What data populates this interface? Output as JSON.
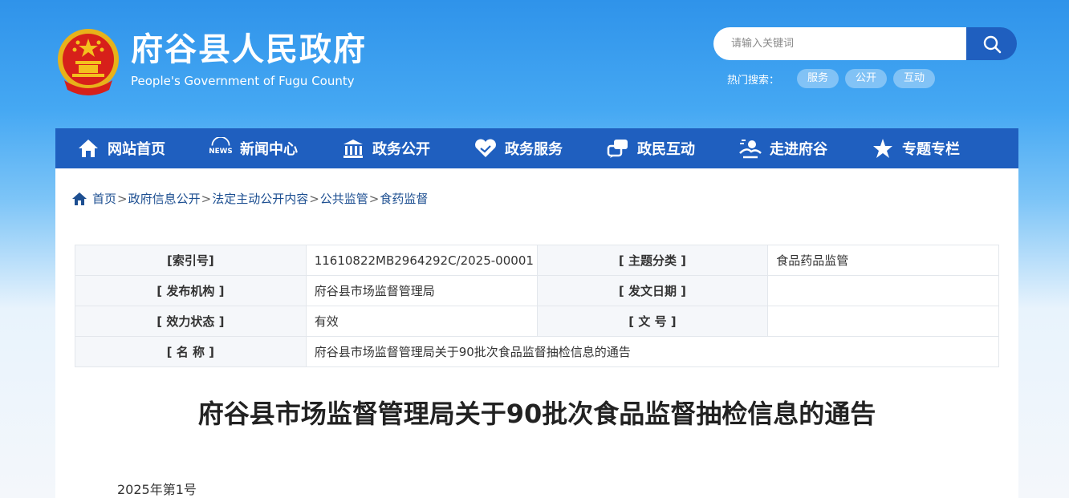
{
  "header": {
    "title": "府谷县人民政府",
    "subtitle": "People's Government of Fugu County",
    "search_placeholder": "请输入关键词",
    "hot_label": "热门搜索：",
    "hot_tags": [
      "服务",
      "公开",
      "互动"
    ]
  },
  "nav": [
    {
      "label": "网站首页",
      "icon": "home-icon"
    },
    {
      "label": "新闻中心",
      "icon": "news-icon"
    },
    {
      "label": "政务公开",
      "icon": "government-building-icon"
    },
    {
      "label": "政务服务",
      "icon": "heart-hand-icon"
    },
    {
      "label": "政民互动",
      "icon": "chat-icon"
    },
    {
      "label": "走进府谷",
      "icon": "landscape-icon"
    },
    {
      "label": "专题专栏",
      "icon": "star-icon"
    }
  ],
  "breadcrumb": [
    "首页",
    "政府信息公开",
    "法定主动公开内容",
    "公共监管",
    "食药监督"
  ],
  "meta": {
    "rows": [
      [
        "[索引号]",
        "11610822MB2964292C/2025-00001",
        "[ 主题分类 ]",
        "食品药品监管"
      ],
      [
        "[ 发布机构 ]",
        "府谷县市场监督管理局",
        "[ 发文日期 ]",
        ""
      ],
      [
        "[ 效力状态 ]",
        "有效",
        "[ 文 号 ]",
        ""
      ]
    ],
    "name_label": "[ 名 称 ]",
    "name_value": "府谷县市场监督管理局关于90批次食品监督抽检信息的通告"
  },
  "article": {
    "title": "府谷县市场监督管理局关于90批次食品监督抽检信息的通告",
    "doc_no": "2025年第1号"
  },
  "colors": {
    "nav_bg": "#1f5fbf",
    "link": "#1d4f91",
    "emblem_red": "#d7201a",
    "emblem_gold": "#f4c01e"
  }
}
